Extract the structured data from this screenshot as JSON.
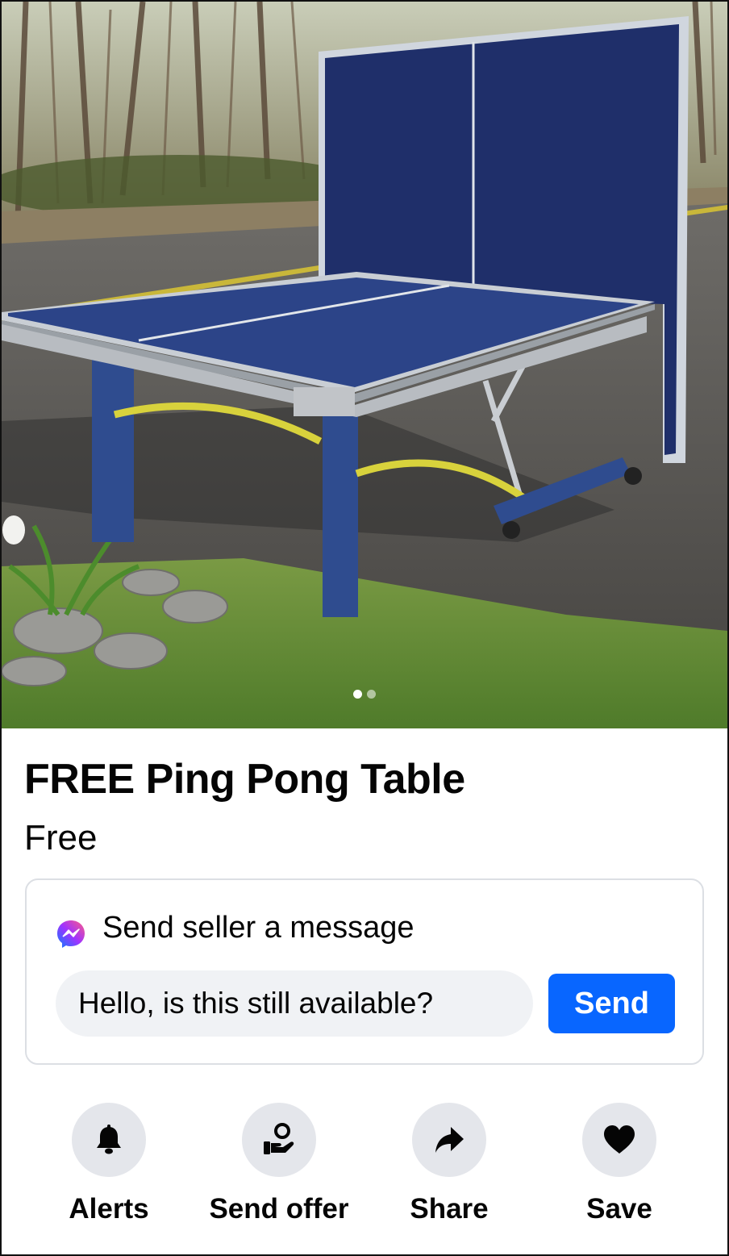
{
  "listing": {
    "title": "FREE Ping Pong Table",
    "price": "Free"
  },
  "photo": {
    "alt_subject": "ping-pong table outdoors",
    "carousel_count": 2,
    "carousel_active_index": 0
  },
  "message_card": {
    "heading": "Send seller a message",
    "input_value": "Hello, is this still available?",
    "send_label": "Send",
    "icon": "messenger-icon"
  },
  "actions": [
    {
      "label": "Alerts",
      "icon": "bell-icon"
    },
    {
      "label": "Send offer",
      "icon": "offer-hand-icon"
    },
    {
      "label": "Share",
      "icon": "share-arrow-icon"
    },
    {
      "label": "Save",
      "icon": "heart-icon"
    }
  ],
  "colors": {
    "send_button": "#0866ff",
    "action_circle": "#e4e6eb",
    "input_background": "#f0f2f5",
    "card_border": "#dcdfe4"
  }
}
